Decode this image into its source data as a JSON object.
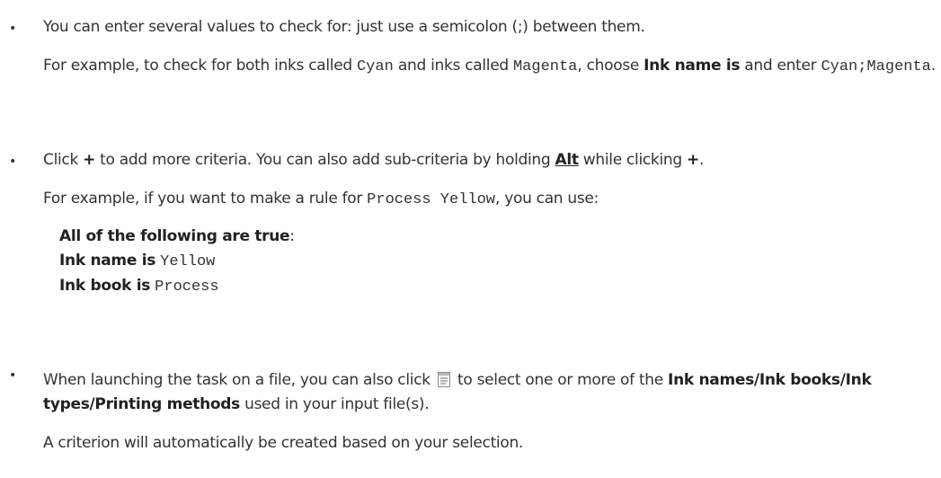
{
  "bullets": {
    "symbol": "•",
    "item1": {
      "line1": "You can enter several values to check for: just use a semicolon (;) between them.",
      "ex_prefix": "For example, to check for both inks called ",
      "ex_code1": "Cyan",
      "ex_mid": " and inks called ",
      "ex_code2": "Magenta",
      "ex_choose": ", choose ",
      "ex_bold": "Ink name is",
      "ex_enter": " and enter ",
      "ex_code3": "Cyan;Magenta",
      "ex_end": "."
    },
    "item2": {
      "click": "Click ",
      "plus1": "+",
      "mid": " to add more criteria. You can also add sub-criteria by holding ",
      "key": "Alt",
      "while": " while clicking ",
      "plus2": "+",
      "end": ".",
      "ex_prefix": "For example, if you want to make a rule for ",
      "ex_code": "Process Yellow",
      "ex_suffix": ", you can use:",
      "rule_all": "All of the following are true",
      "rule_colon": ":",
      "rule1_label": "Ink name is",
      "rule1_value": "Yellow",
      "rule2_label": "Ink book is",
      "rule2_value": "Process"
    },
    "item3": {
      "prefix": "When launching the task on a file, you can also click ",
      "icon": "list-select-icon",
      "mid": " to select one or more of the ",
      "bold": "Ink names/Ink books/Ink types/Printing methods",
      "suffix": " used in your input file(s).",
      "note": "A criterion will automatically be created based on your selection."
    }
  }
}
